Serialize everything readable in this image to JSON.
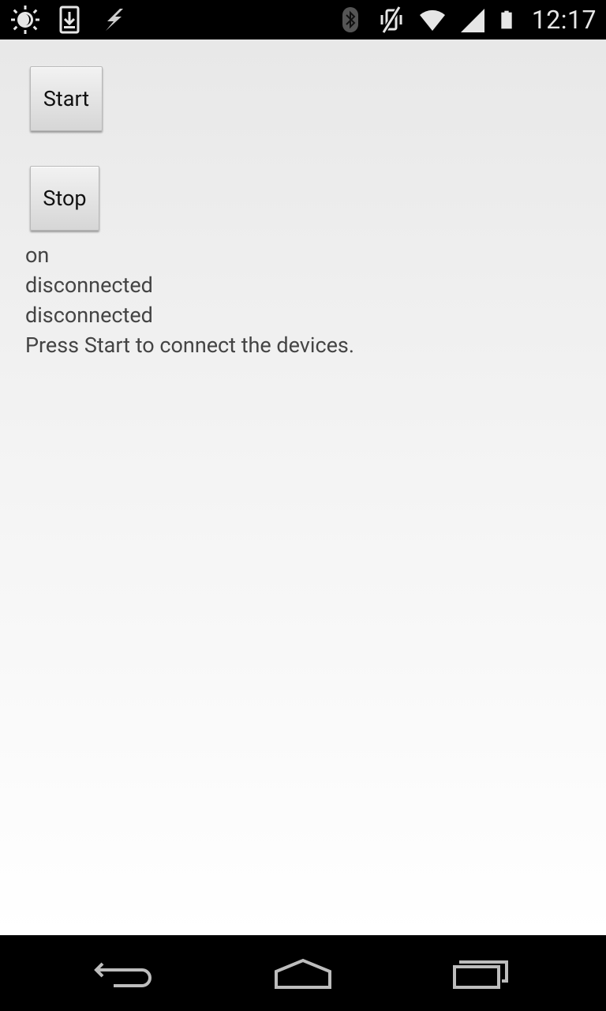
{
  "status_bar": {
    "time": "12:17",
    "left_icons": [
      "brightness-icon",
      "download-icon",
      "flash-icon"
    ],
    "right_icons": [
      "bluetooth-icon",
      "vibrate-mute-icon",
      "wifi-icon",
      "signal-icon",
      "battery-icon"
    ]
  },
  "main": {
    "start_label": "Start",
    "stop_label": "Stop",
    "lines": [
      "on",
      "disconnected",
      "disconnected",
      "Press Start to connect the devices."
    ]
  },
  "nav_bar": {
    "buttons": [
      "back-icon",
      "home-icon",
      "recent-apps-icon"
    ]
  },
  "colors": {
    "status_bar_bg": "#000000",
    "status_icon": "#e6e6e6",
    "text": "#444444"
  }
}
